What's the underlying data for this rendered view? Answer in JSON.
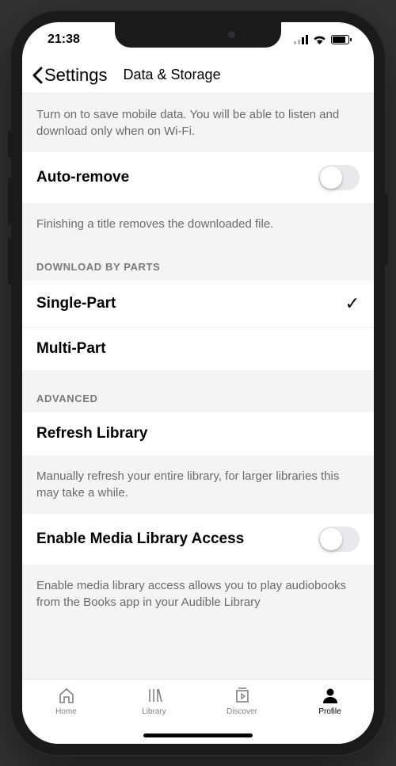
{
  "status": {
    "time": "21:38"
  },
  "nav": {
    "back_label": "Settings",
    "title": "Data & Storage"
  },
  "wifi_only_desc": "Turn on to save mobile data. You will be able to listen and download only when on Wi-Fi.",
  "auto_remove": {
    "label": "Auto-remove",
    "desc": "Finishing a title removes the downloaded file."
  },
  "download_parts": {
    "header": "DOWNLOAD BY PARTS",
    "single": "Single-Part",
    "multi": "Multi-Part"
  },
  "advanced": {
    "header": "ADVANCED",
    "refresh_label": "Refresh Library",
    "refresh_desc": "Manually refresh your entire library, for larger libraries this may take a while.",
    "media_access_label": "Enable Media Library Access",
    "media_access_desc": "Enable media library access allows you to play audiobooks from the Books app in your Audible Library"
  },
  "tabs": {
    "home": "Home",
    "library": "Library",
    "discover": "Discover",
    "profile": "Profile"
  }
}
